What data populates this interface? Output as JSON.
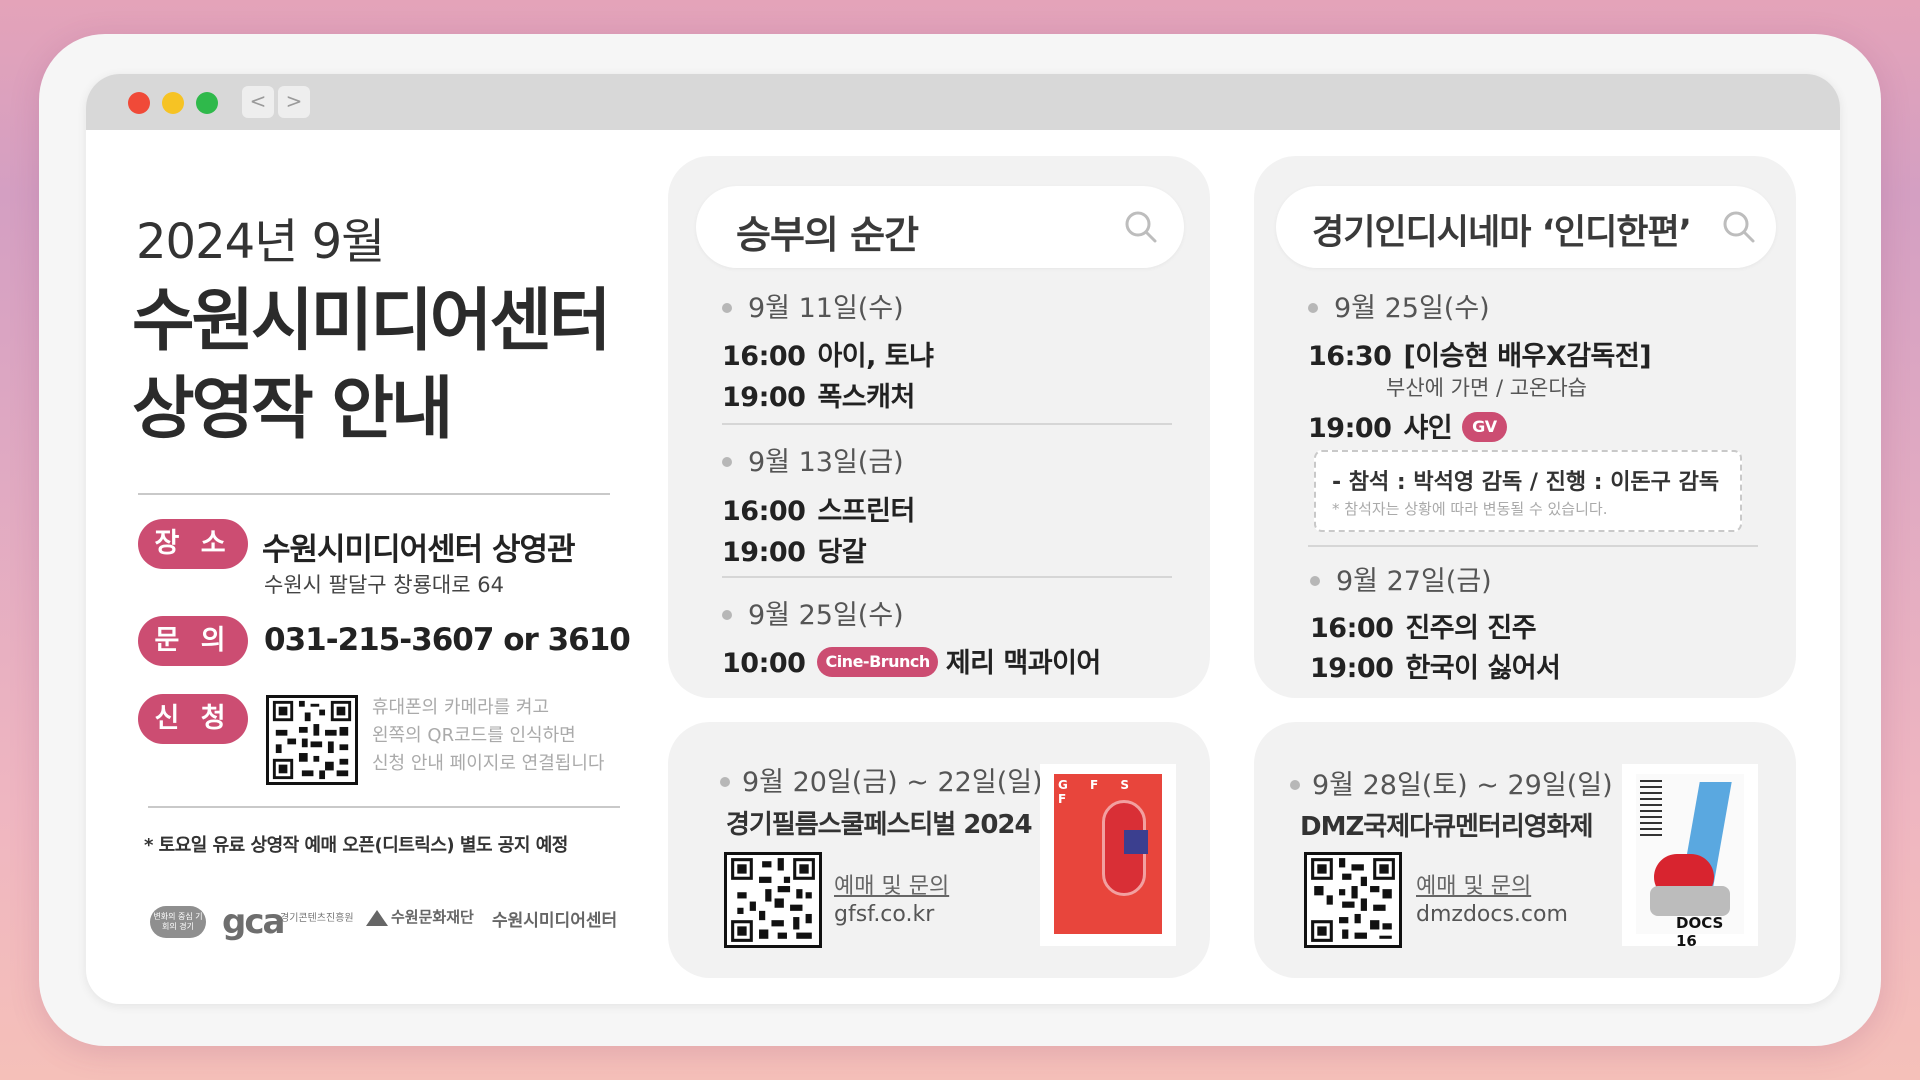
{
  "window": {
    "nav_back": "<",
    "nav_forward": ">"
  },
  "left": {
    "date_title": "2024년 9월",
    "title_line1": "수원시미디어센터",
    "title_line2": "상영작 안내",
    "venue_label": "장 소",
    "venue_name": "수원시미디어센터 상영관",
    "venue_address": "수원시 팔달구 창룡대로 64",
    "contact_label": "문 의",
    "contact_phone": "031-215-3607 or 3610",
    "apply_label": "신 청",
    "qr_note_1": "휴대폰의 카메라를 켜고",
    "qr_note_2": "왼쪽의 QR코드를 인식하면",
    "qr_note_3": "신청 안내 페이지로 연결됩니다",
    "notice": "* 토요일 유료 상영작 예매 오픈(디트릭스) 별도 공지 예정",
    "logos": {
      "logo1": "변화의 중심 기회의 경기",
      "logo2": "gca",
      "logo2_sub": "경기콘텐츠진흥원",
      "logo3": "수원문화재단",
      "logo4": "수원시미디어센터"
    }
  },
  "card1": {
    "title": "승부의 순간",
    "groups": [
      {
        "day": "9월 11일(수)",
        "shows": [
          {
            "time": "16:00",
            "title": "아이, 토냐"
          },
          {
            "time": "19:00",
            "title": "폭스캐처"
          }
        ]
      },
      {
        "day": "9월 13일(금)",
        "shows": [
          {
            "time": "16:00",
            "title": "스프린터"
          },
          {
            "time": "19:00",
            "title": "당갈"
          }
        ]
      },
      {
        "day": "9월 25일(수)",
        "shows": [
          {
            "time": "10:00",
            "badge": "Cine-Brunch",
            "title": "제리 맥과이어"
          }
        ]
      }
    ]
  },
  "card2": {
    "title": "경기인디시네마 ‘인디한편’",
    "groups": [
      {
        "day": "9월 25일(수)",
        "show1_time": "16:30",
        "show1_title": "[이승현 배우X감독전]",
        "show1_sub": "부산에 가면 / 고온다습",
        "show2_time": "19:00",
        "show2_title": "샤인",
        "show2_badge": "GV",
        "note_main": "- 참석 : 박석영 감독 / 진행 : 이돈구 감독",
        "note_sub": "* 참석자는 상황에 따라 변동될 수 있습니다."
      },
      {
        "day": "9월 27일(금)",
        "shows": [
          {
            "time": "16:00",
            "title": "진주의 진주"
          },
          {
            "time": "19:00",
            "title": "한국이 싫어서"
          }
        ]
      }
    ]
  },
  "fest1": {
    "date": "9월 20일(금) ~ 22일(일)",
    "name": "경기필름스쿨페스티벌 2024",
    "link_label": "예매 및 문의",
    "url": "gfsf.co.kr",
    "poster_text": "G F S F"
  },
  "fest2": {
    "date": "9월 28일(토) ~ 29일(일)",
    "name": "DMZ국제다큐멘터리영화제",
    "link_label": "예매 및 문의",
    "url": "dmzdocs.com",
    "poster_text": "DOCS 16"
  },
  "colors": {
    "accent": "#cc4d72",
    "card_bg": "#f2f2f2",
    "poster1": "#e8453c",
    "poster2_blue": "#5aa8e0"
  }
}
